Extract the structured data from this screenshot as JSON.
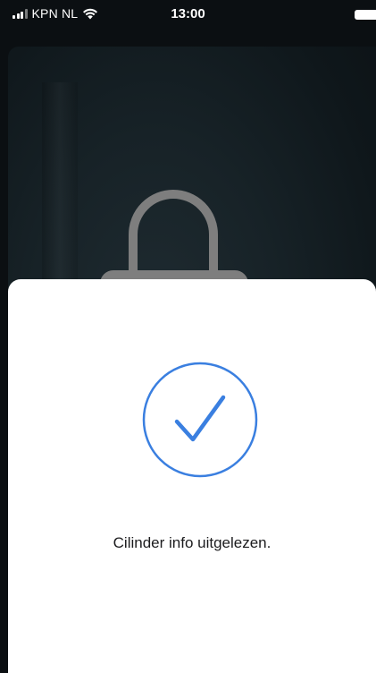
{
  "status_bar": {
    "carrier": "KPN NL",
    "time": "13:00",
    "icons": [
      "signal-icon",
      "wifi-icon",
      "battery-icon"
    ]
  },
  "background": {
    "illustration": "lock-icon"
  },
  "sheet": {
    "icon": "checkmark-circle-icon",
    "message": "Cilinder info uitgelezen.",
    "accent_color": "#3a7fe0"
  }
}
